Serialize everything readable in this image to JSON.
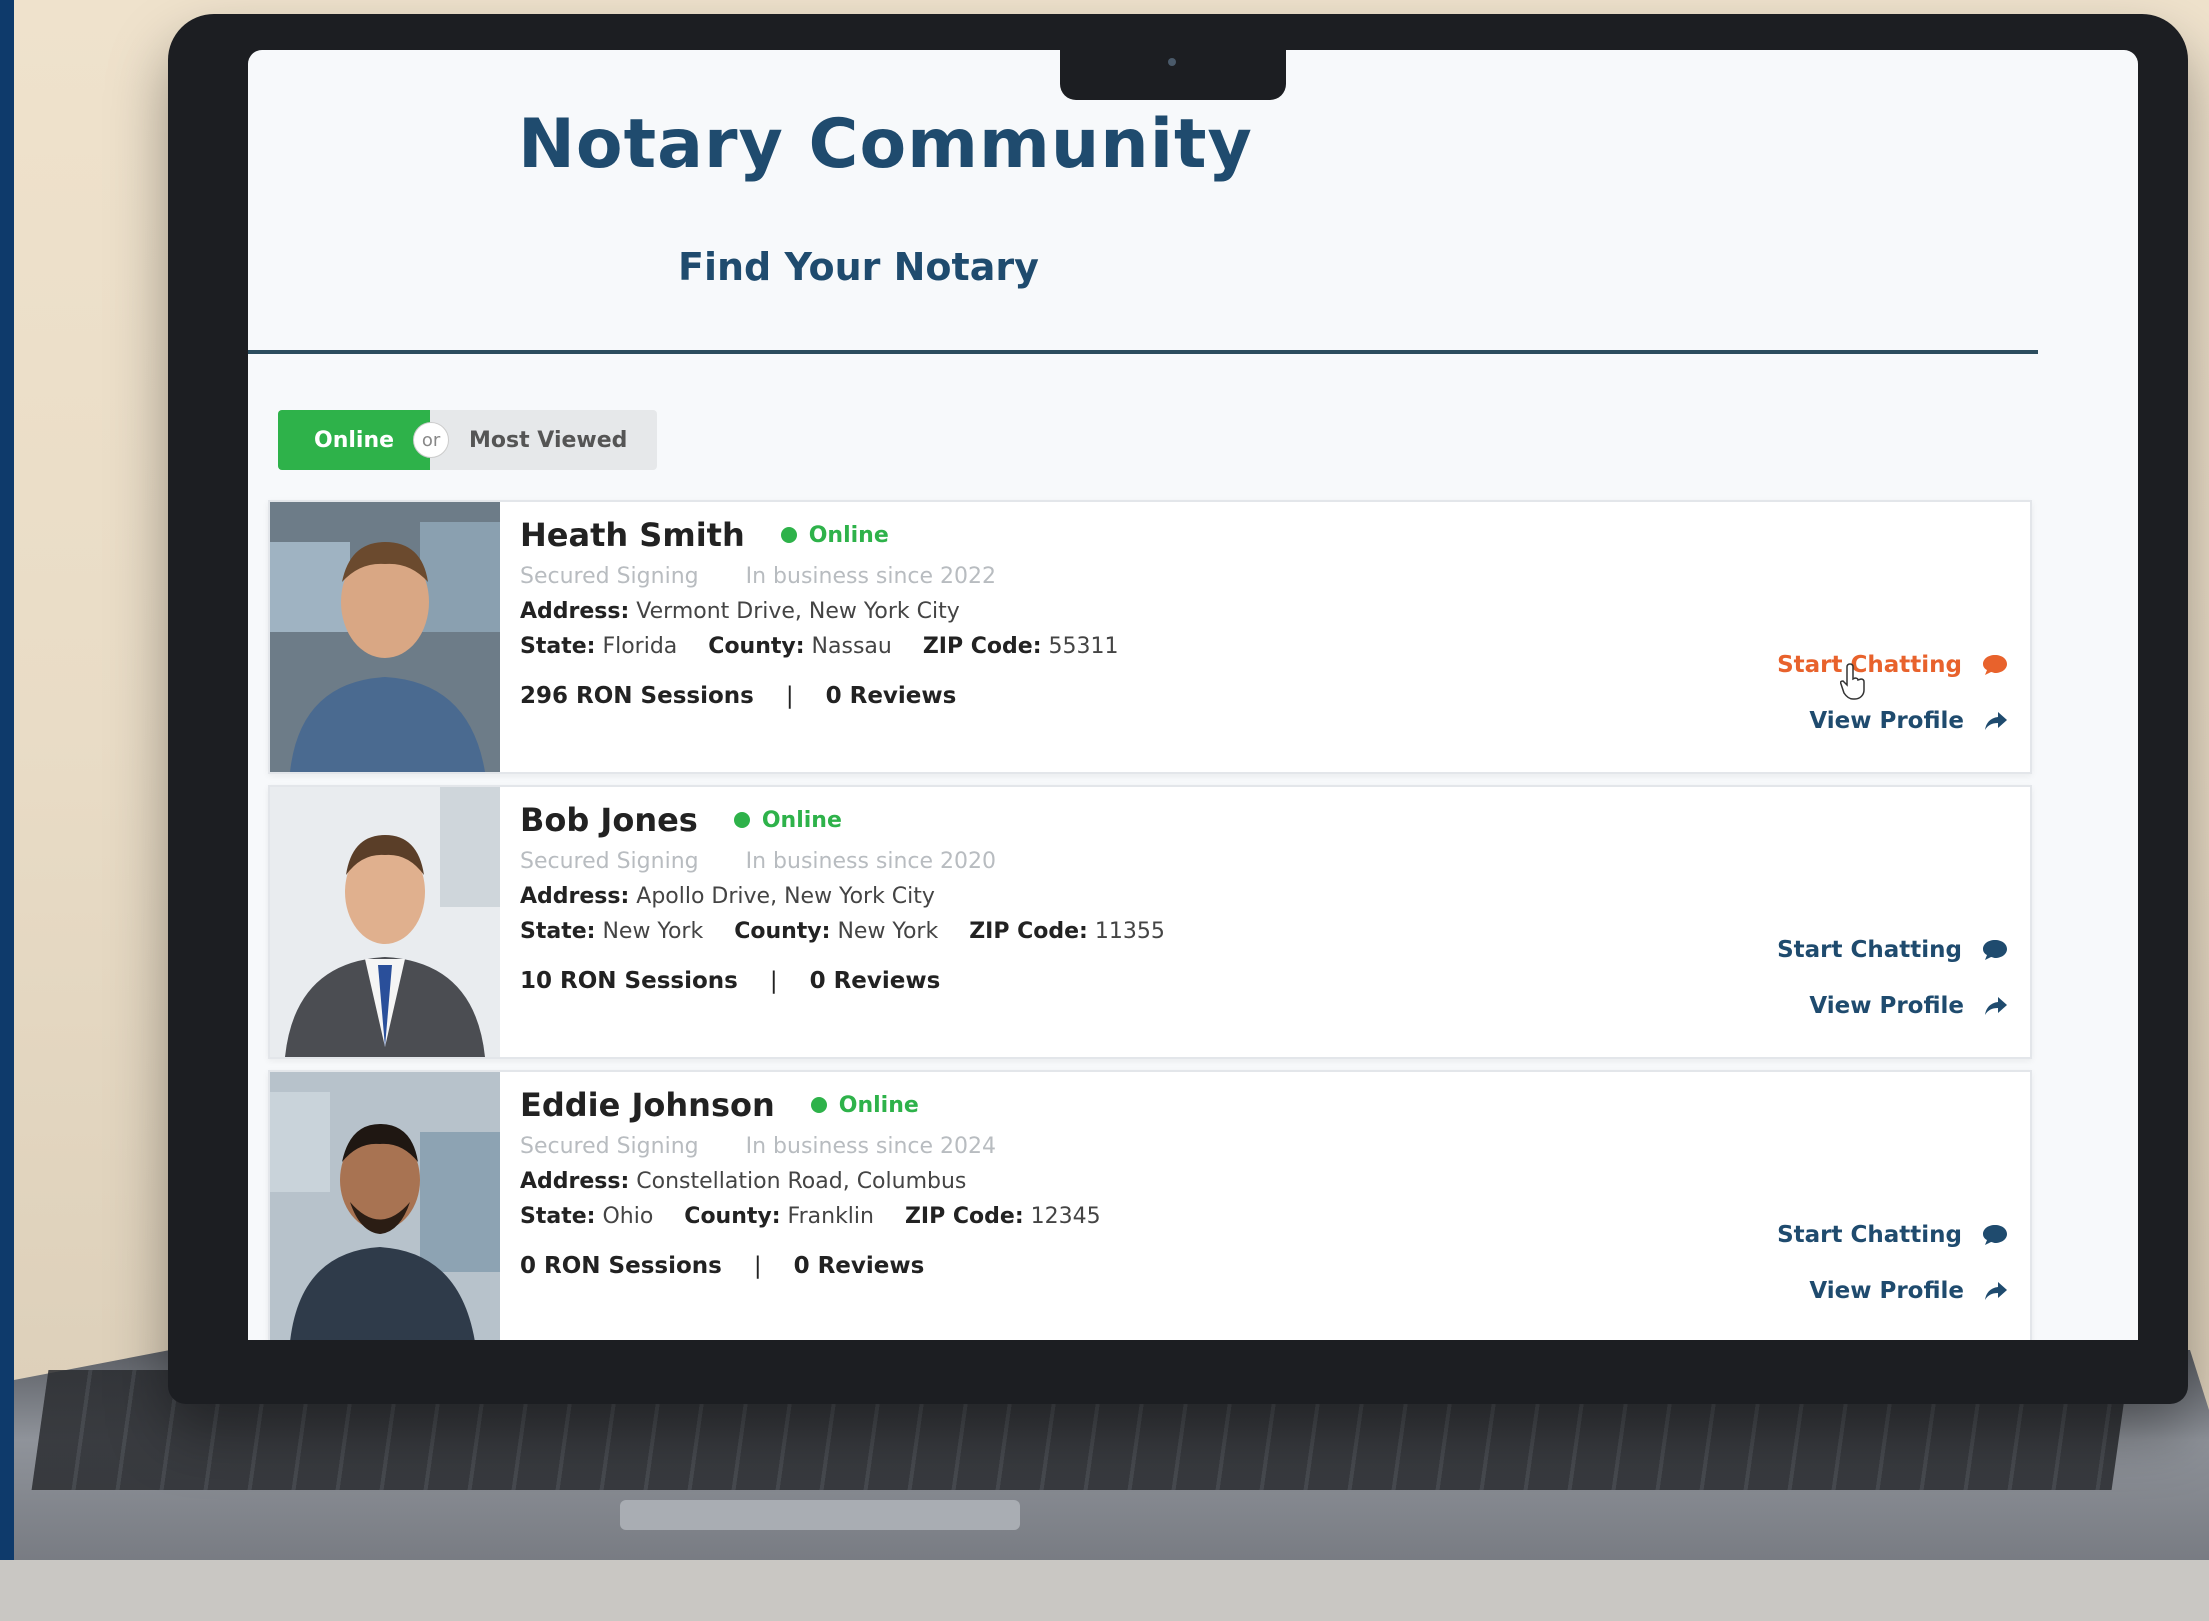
{
  "header": {
    "title": "Notary Community",
    "subtitle": "Find Your Notary"
  },
  "filter": {
    "online_label": "Online",
    "or_label": "or",
    "most_viewed_label": "Most Viewed"
  },
  "notaries": [
    {
      "name": "Heath Smith",
      "status": "Online",
      "service": "Secured Signing",
      "since": "In business since 2022",
      "address_label": "Address:",
      "address": "Vermont Drive, New York City",
      "state_label": "State:",
      "state": "Florida",
      "county_label": "County:",
      "county": "Nassau",
      "zip_label": "ZIP Code:",
      "zip": "55311",
      "sessions": "296 RON Sessions",
      "reviews": "0 Reviews",
      "chat_label": "Start Chatting",
      "profile_label": "View Profile"
    },
    {
      "name": "Bob Jones",
      "status": "Online",
      "service": "Secured Signing",
      "since": "In business since 2020",
      "address_label": "Address:",
      "address": "Apollo Drive, New York City",
      "state_label": "State:",
      "state": "New York",
      "county_label": "County:",
      "county": "New York",
      "zip_label": "ZIP Code:",
      "zip": "11355",
      "sessions": "10 RON Sessions",
      "reviews": "0 Reviews",
      "chat_label": "Start Chatting",
      "profile_label": "View Profile"
    },
    {
      "name": "Eddie Johnson",
      "status": "Online",
      "service": "Secured Signing",
      "since": "In business since 2024",
      "address_label": "Address:",
      "address": "Constellation Road, Columbus",
      "state_label": "State:",
      "state": "Ohio",
      "county_label": "County:",
      "county": "Franklin",
      "zip_label": "ZIP Code:",
      "zip": "12345",
      "sessions": "0 RON Sessions",
      "reviews": "0 Reviews",
      "chat_label": "Start Chatting",
      "profile_label": "View Profile"
    }
  ],
  "separator": "|",
  "colors": {
    "brand": "#1f4b6e",
    "online": "#2eb24a",
    "chat_hover": "#e8622c"
  },
  "icons": {
    "chat": "chat-bubble-icon",
    "profile": "share-arrow-icon",
    "status": "online-dot-icon",
    "cursor": "hand-cursor-icon"
  }
}
